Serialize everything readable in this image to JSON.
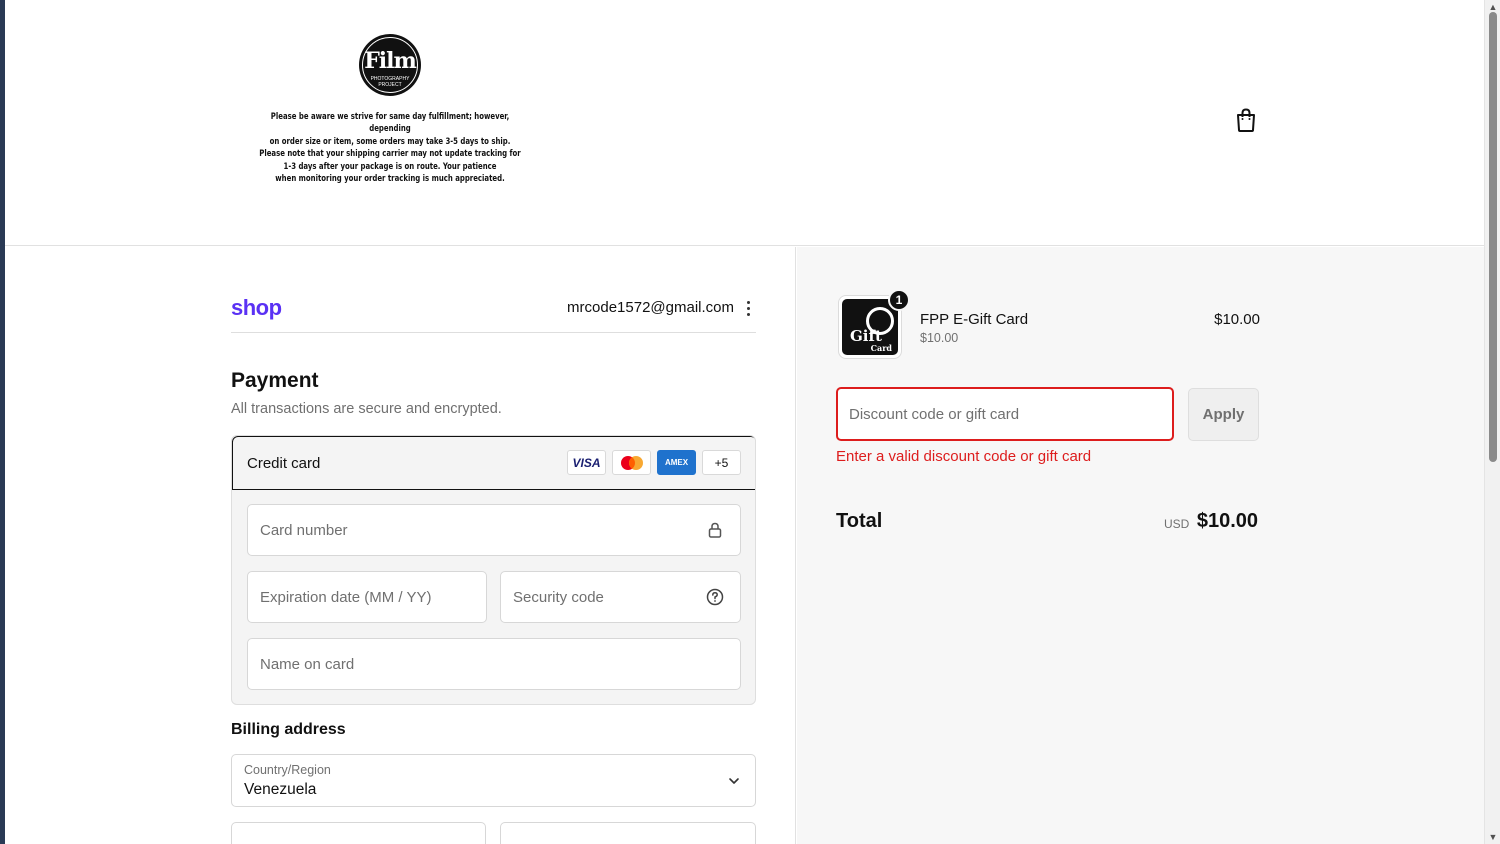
{
  "header": {
    "logo_text": "Film",
    "logo_subtext": "PHOTOGRAPHY PROJECT",
    "notice_lines": [
      "Please be aware we strive for same day fulfillment; however, depending",
      "on order size or item, some orders may take 3-5 days to ship.",
      "Please note that your shipping carrier may not update tracking for",
      "1-3 days after your package is on route. Your patience",
      "when monitoring your order tracking is much appreciated."
    ],
    "cart_icon": "shopping-bag-icon"
  },
  "account": {
    "shop_logo": "shop",
    "email": "mrcode1572@gmail.com",
    "menu_icon": "kebab-menu-icon"
  },
  "payment": {
    "title": "Payment",
    "subtitle": "All transactions are secure and encrypted.",
    "method_label": "Credit card",
    "brands": {
      "visa": "VISA",
      "mastercard": "mastercard-icon",
      "amex": "AMEX",
      "more": "+5"
    },
    "card_number_placeholder": "Card number",
    "expiry_placeholder": "Expiration date (MM / YY)",
    "security_placeholder": "Security code",
    "name_placeholder": "Name on card"
  },
  "billing": {
    "title": "Billing address",
    "country_label": "Country/Region",
    "country_value": "Venezuela"
  },
  "summary": {
    "product": {
      "thumb_text": "Gift",
      "thumb_subtext": "Card",
      "quantity": "1",
      "name": "FPP E-Gift Card",
      "unit_price": "$10.00",
      "price": "$10.00"
    },
    "discount_placeholder": "Discount code or gift card",
    "apply_label": "Apply",
    "error": "Enter a valid discount code or gift card",
    "total_label": "Total",
    "currency": "USD",
    "total_value": "$10.00"
  },
  "colors": {
    "shop_purple": "#5a31f4",
    "error_red": "#dd1d1d",
    "amex_blue": "#1f72cd"
  }
}
